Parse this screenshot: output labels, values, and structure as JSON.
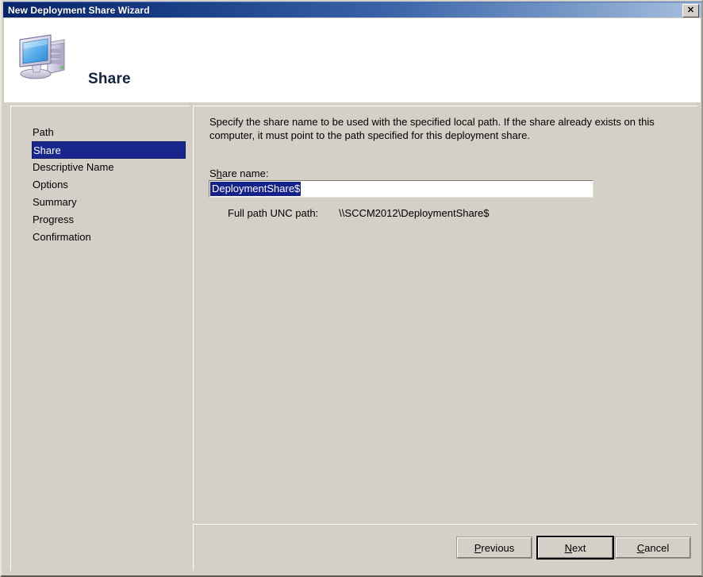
{
  "window": {
    "title": "New Deployment Share Wizard",
    "close_label": "✕"
  },
  "header": {
    "icon": "computer-icon",
    "title": "Share"
  },
  "sidebar": {
    "items": [
      {
        "label": "Path",
        "selected": false
      },
      {
        "label": "Share",
        "selected": true
      },
      {
        "label": "Descriptive Name",
        "selected": false
      },
      {
        "label": "Options",
        "selected": false
      },
      {
        "label": "Summary",
        "selected": false
      },
      {
        "label": "Progress",
        "selected": false
      },
      {
        "label": "Confirmation",
        "selected": false
      }
    ]
  },
  "main": {
    "intro": "Specify the share name to be used with the specified local path.  If the share already exists on this computer, it must point to the path specified for this deployment share.",
    "field_label_pre": "S",
    "field_label_accel": "h",
    "field_label_post": "are name:",
    "share_name_value": "DeploymentShare$",
    "share_name_placeholder": "",
    "unc_label": "Full path UNC path:",
    "unc_value": "\\\\SCCM2012\\DeploymentShare$"
  },
  "buttons": {
    "previous": {
      "pre": "",
      "accel": "P",
      "post": "revious"
    },
    "next": {
      "pre": "",
      "accel": "N",
      "post": "ext"
    },
    "cancel": {
      "pre": "",
      "accel": "C",
      "post": "ancel"
    }
  },
  "colors": {
    "titlebar_dark": "#0a246a",
    "titlebar_light": "#a8c0de",
    "window_face": "#d4d0c8",
    "selection_blue": "#19278c",
    "header_bg": "#ffffff"
  }
}
